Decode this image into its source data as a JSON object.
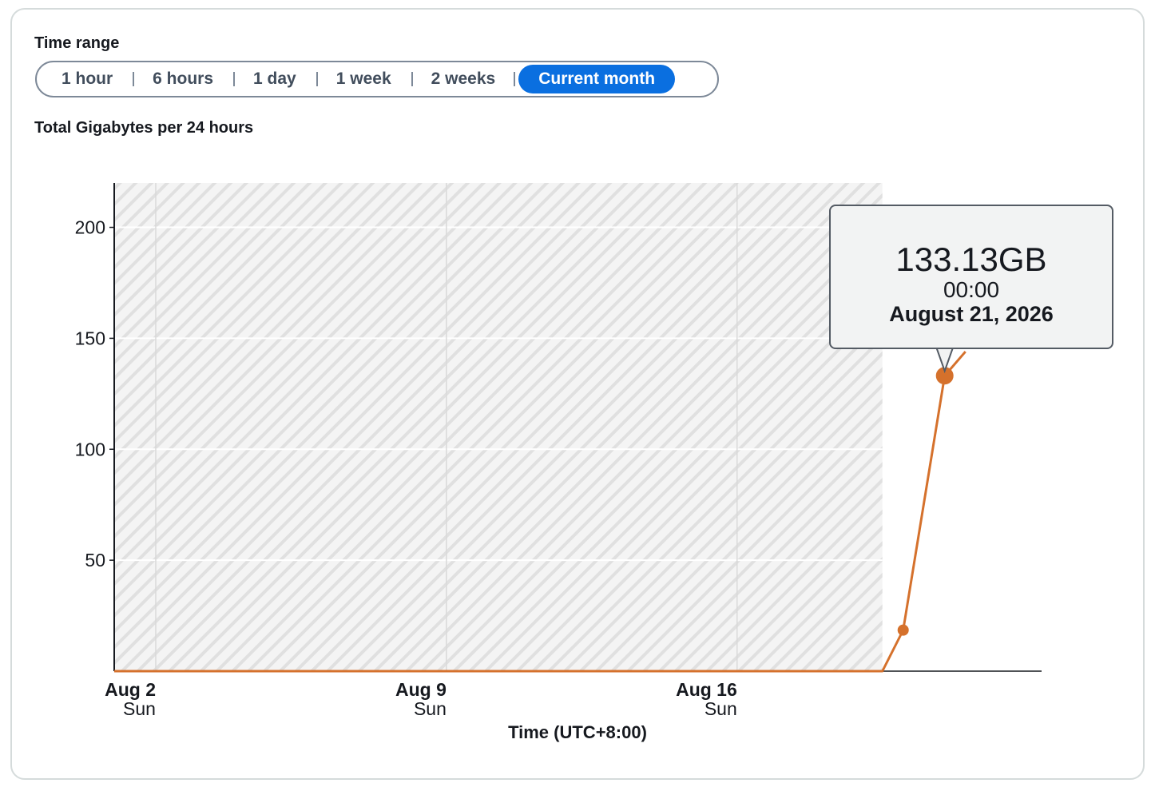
{
  "time_range": {
    "label": "Time range",
    "options": [
      "1 hour",
      "6 hours",
      "1 day",
      "1 week",
      "2 weeks",
      "Current month"
    ],
    "selected": "Current month"
  },
  "chart_data": {
    "type": "line",
    "title": "Total Gigabytes per 24 hours",
    "xlabel": "Time (UTC+8:00)",
    "ylabel": "",
    "x_ticks": [
      {
        "date": "Aug 2",
        "day": "Sun"
      },
      {
        "date": "Aug 9",
        "day": "Sun"
      },
      {
        "date": "Aug 16",
        "day": "Sun"
      }
    ],
    "y_ticks": [
      50,
      100,
      150,
      200
    ],
    "ylim": [
      0,
      220
    ],
    "xlim": [
      "2026-08-01T00:00",
      "2026-08-23T08:00"
    ],
    "no_data_region": [
      "2026-08-01T00:00",
      "2026-08-19T12:00"
    ],
    "grid": true,
    "series": [
      {
        "color": "#d5712c",
        "points": [
          {
            "x": "2026-08-01T00:00",
            "y": 0
          },
          {
            "x": "2026-08-19T12:00",
            "y": 0
          },
          {
            "x": "2026-08-20T00:00",
            "y": 18.5
          },
          {
            "x": "2026-08-21T00:00",
            "y": 133.13
          },
          {
            "x": "2026-08-21T12:00",
            "y": 144
          }
        ]
      }
    ],
    "markers": [
      "2026-08-20T00:00",
      "2026-08-21T00:00"
    ],
    "highlighted_point": {
      "x": "2026-08-21T00:00",
      "y": 133.13
    }
  },
  "tooltip": {
    "value": "133.13GB",
    "time": "00:00",
    "date": "August 21, 2026"
  }
}
